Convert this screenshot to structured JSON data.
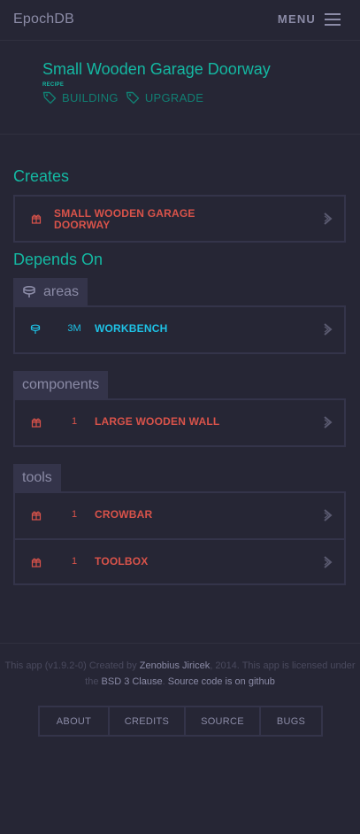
{
  "app": {
    "brand": "EpochDB",
    "menu_label": "MENU"
  },
  "item": {
    "title": "Small Wooden Garage Doorway",
    "type": "RECIPE",
    "tags": [
      "BUILDING",
      "UPGRADE"
    ]
  },
  "creates": {
    "heading": "Creates",
    "items": [
      {
        "line1": "SMALL WOODEN GARAGE",
        "line2": "DOORWAY",
        "icon": "gift-icon"
      }
    ]
  },
  "depends": {
    "heading": "Depends On",
    "groups": [
      {
        "label": "areas",
        "icon": "area-icon",
        "items": [
          {
            "qty": "3M",
            "name": "WORKBENCH",
            "icon": "area-icon"
          }
        ]
      },
      {
        "label": "components",
        "items": [
          {
            "qty": "1",
            "name": "LARGE WOODEN WALL",
            "icon": "gift-icon"
          }
        ]
      },
      {
        "label": "tools",
        "items": [
          {
            "qty": "1",
            "name": "CROWBAR",
            "icon": "gift-icon"
          },
          {
            "qty": "1",
            "name": "TOOLBOX",
            "icon": "gift-icon"
          }
        ]
      }
    ]
  },
  "footer": {
    "p1": "This app (v1.9.2-0) Created by ",
    "author": "Zenobius Jiricek",
    "p2": ", 2014. This app is licensed under",
    "p3": "the ",
    "license": "BSD 3 Clause",
    "p4": ". ",
    "source_link": "Source code is on github",
    "nav": [
      "ABOUT",
      "CREDITS",
      "SOURCE",
      "BUGS"
    ]
  },
  "colors": {
    "accent": "#14b8a2",
    "item": "#d9534a",
    "area": "#1ec2e6",
    "bg": "#262635"
  }
}
